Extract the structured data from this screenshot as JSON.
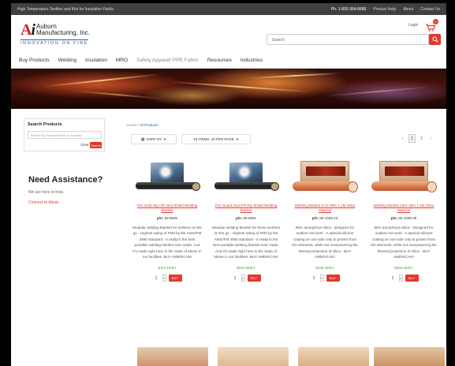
{
  "topbar": {
    "announcement": "High Temperature Textiles and Kits for Insulation Fields",
    "phone": "Ph: 1-800-364-6689",
    "links": [
      "Product Help",
      "About",
      "Contact Us"
    ]
  },
  "header": {
    "logo_mark": "A",
    "logo_mark_i": "i",
    "company_line1": "Auburn",
    "company_line2": "Manufacturing, Inc.",
    "tagline": "INNOVATION ON FIRE",
    "login_label": "Login",
    "cart_count": "0",
    "search_placeholder": "Search"
  },
  "nav": {
    "items": [
      "Buy Products",
      "Welding",
      "Insulation",
      "MRO",
      "Safety Apparel/ PPE Fabric",
      "Resources",
      "Industries"
    ]
  },
  "sidebar": {
    "search_title": "Search Products",
    "search_placeholder": "Search by Product Name or Number",
    "clear_label": "Clear",
    "go_label": "Search",
    "assist_title": "Need Assistance?",
    "assist_text": "We are here to help.",
    "assist_link": "Connect to Alexis"
  },
  "breadcrumb": {
    "home": "Home",
    "separator": "/",
    "current": "All Products"
  },
  "toolbar": {
    "sort_label": "SORT BY",
    "per_page_label": "23 ITEMS, 20 PER PAGE"
  },
  "pager": {
    "prev": "‹",
    "pages": [
      "1",
      "2"
    ],
    "next": "›"
  },
  "products": [
    {
      "title": "Fire Grab Rip-Off Heat Shield Welding Blanket",
      "pn_label": "p/n:",
      "pn": "90-8500",
      "description": "Modular welding blanket for workers on the go - Highest rating of FM3 by the ANSI/FM 4950 standard - It really is the best portable welding blanket ever made. And it's made right here in the State of Maine in our facilities. BUY AMERICAN!",
      "price": "$112.16/EA",
      "qty": "1",
      "add_label": "BUY"
    },
    {
      "title": "Fire Guard Dual FR Rip Shield Welding Blanket",
      "pn_label": "p/n:",
      "pn": "90-8501",
      "description": "Modular welding blanket for those workers on the go - Highest rating of FM3 by the ANSI/FM 4950 standard - It really is the best portable welding blanket ever made. And it's made right here in the State of Maine in our facilities. BUY AMERICAN!",
      "price": "$344.85/EA",
      "qty": "1",
      "add_label": "BUY"
    },
    {
      "title": "Welding Blanket 8 Oz 98% 1.2M Silica Material",
      "pn_label": "p/n:",
      "pn": "80-1028-13",
      "description": "96% amorphous silica - designed for outdoor hot work - A special silicone coating on one side only to protect from the elements, while not overpowering the thermal protection of silica - BUY AMERICAN!",
      "price": "$125.39/EA",
      "qty": "1",
      "add_label": "BUY"
    },
    {
      "title": "Welding Blanket 18oz 98% 1.2M Silica Material",
      "pn_label": "p/n:",
      "pn": "80-1028-35",
      "description": "96% amorphous silica - Designed for outdoor hot work - A special silicone coating on one side only to protect from the elements, while not overpowering the thermal protection of silica - BUY AMERICAN!",
      "price": "$255.48/EA",
      "qty": "1",
      "add_label": "BUY"
    }
  ],
  "colors": {
    "accent": "#e5392e",
    "link_blue": "#2b5d9c",
    "price_green": "#4c9a3a",
    "topbar": "#404040"
  }
}
